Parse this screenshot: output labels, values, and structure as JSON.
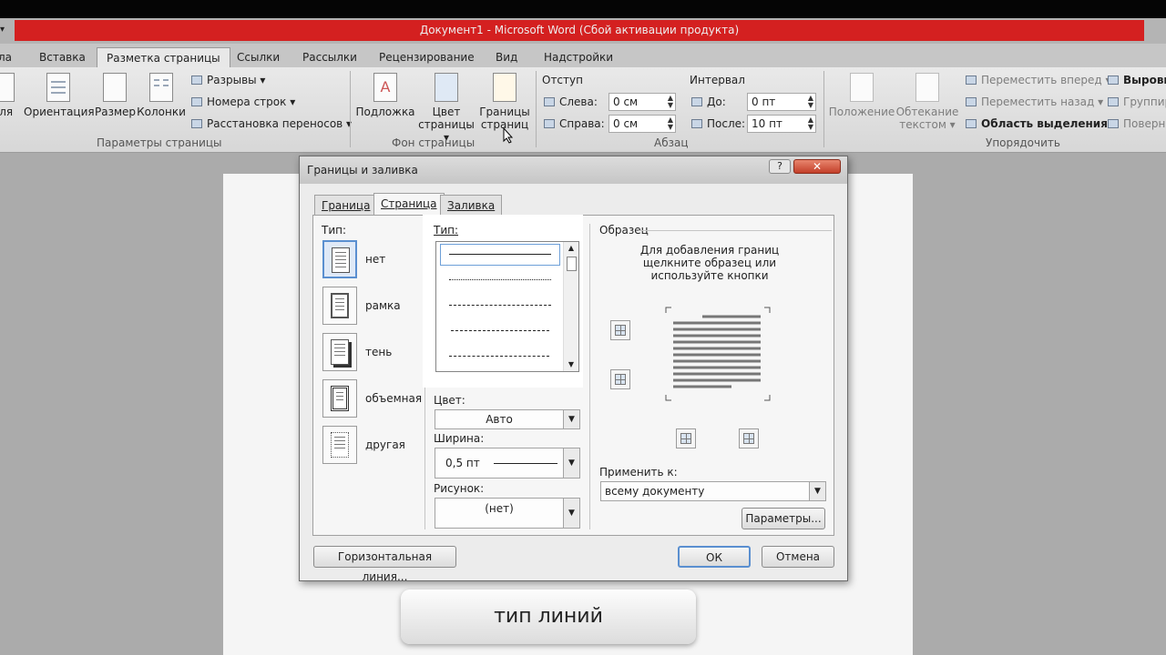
{
  "window": {
    "title": "Документ1  -  Microsoft Word (Сбой активации продукта)",
    "qat_glyph": "▾"
  },
  "ribbon_tabs": [
    {
      "label": "ла"
    },
    {
      "label": "Вставка"
    },
    {
      "label": "Разметка страницы"
    },
    {
      "label": "Ссылки"
    },
    {
      "label": "Рассылки"
    },
    {
      "label": "Рецензирование"
    },
    {
      "label": "Вид"
    },
    {
      "label": "Надстройки"
    }
  ],
  "ribbon": {
    "page_setup": {
      "fields": "оля",
      "orientation": "Ориентация",
      "size": "Размер",
      "columns": "Колонки",
      "breaks": "Разрывы ▾",
      "line_numbers": "Номера строк ▾",
      "hyphenation": "Расстановка переносов ▾",
      "group": "Параметры страницы"
    },
    "page_background": {
      "watermark": "Подложка",
      "page_color_l1": "Цвет",
      "page_color_l2": "страницы ▾",
      "page_borders_l1": "Границы",
      "page_borders_l2": "страниц",
      "group": "Фон страницы"
    },
    "paragraph": {
      "indent": "Отступ",
      "left_label": "Слева:",
      "left_value": "0 см",
      "right_label": "Справа:",
      "right_value": "0 см",
      "spacing": "Интервал",
      "before_label": "До:",
      "before_value": "0 пт",
      "after_label": "После:",
      "after_value": "10 пт",
      "group": "Абзац"
    },
    "arrange": {
      "position": "Положение",
      "wrap_l1": "Обтекание",
      "wrap_l2": "текстом ▾",
      "bring_forward": "Переместить вперед ▾",
      "send_backward": "Переместить назад ▾",
      "selection_pane": "Область выделения",
      "align": "Выровн",
      "group_btn": "Группир",
      "rotate": "Поверн",
      "group": "Упорядочить"
    }
  },
  "dialog": {
    "title": "Границы и заливка",
    "help": "?",
    "close": "✕",
    "tabs": [
      {
        "label": "Граница"
      },
      {
        "label": "Страница"
      },
      {
        "label": "Заливка"
      }
    ],
    "type_label": "Тип:",
    "types": [
      {
        "label": "нет"
      },
      {
        "label": "рамка"
      },
      {
        "label": "тень"
      },
      {
        "label": "объемная"
      },
      {
        "label": "другая"
      }
    ],
    "style_label": "Тип:",
    "color_label": "Цвет:",
    "color_value": "Авто",
    "width_label": "Ширина:",
    "width_value": "0,5 пт",
    "art_label": "Рисунок:",
    "art_value": "(нет)",
    "preview_label": "Образец",
    "preview_hint_1": "Для добавления границ",
    "preview_hint_2": "щелкните образец или",
    "preview_hint_3": "используйте кнопки",
    "apply_label": "Применить к:",
    "apply_value": "всему документу",
    "options_button": "Параметры...",
    "horizontal_line_button": "Горизонтальная линия...",
    "ok_button": "ОК",
    "cancel_button": "Отмена"
  },
  "caption": "тип линий"
}
